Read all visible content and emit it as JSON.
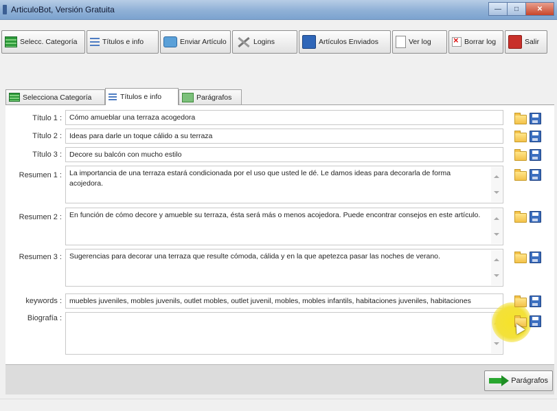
{
  "window": {
    "title": "ArticuloBot, Versión Gratuita"
  },
  "toolbar": {
    "select_category": "Selecc. Categoría",
    "titles_info": "Títulos e info",
    "send_article": "Enviar Artículo",
    "login": "Logins",
    "sent_articles": "Artículos Enviados",
    "view_log": "Ver log",
    "delete_log": "Borrar log",
    "exit": "Salir"
  },
  "tabs": [
    {
      "label": "Selecciona Categoría",
      "active": false
    },
    {
      "label": "Títulos e info",
      "active": true
    },
    {
      "label": "Parágrafos",
      "active": false
    }
  ],
  "form": {
    "titulo1": {
      "label": "Título 1 :",
      "value": "Cómo amueblar una terraza acogedora"
    },
    "titulo2": {
      "label": "Título 2 :",
      "value": "Ideas para darle un toque cálido a su terraza"
    },
    "titulo3": {
      "label": "Título 3 :",
      "value": "Decore su balcón con mucho estilo"
    },
    "resumen1": {
      "label": "Resumen 1 :",
      "value": "La importancia de una terraza estará condicionada por el uso que usted le dé. Le damos ideas para decorarla de forma acojedora."
    },
    "resumen2": {
      "label": "Resumen 2 :",
      "value": "En función de cómo decore y amueble su terraza, ésta será más o menos acojedora. Puede encontrar consejos en este artículo."
    },
    "resumen3": {
      "label": "Resumen 3 :",
      "value": "Sugerencias para decorar una terraza que resulte cómoda, cálida y en la que apetezca pasar las noches de verano."
    },
    "keywords": {
      "label": "keywords :",
      "value": "muebles juveniles, mobles juvenils, outlet mobles, outlet juvenil, mobles, mobles infantils, habitaciones juveniles, habitaciones"
    },
    "biografia": {
      "label": "Biografía :",
      "value": ""
    }
  },
  "footer": {
    "next_label": "Parágrafos"
  }
}
